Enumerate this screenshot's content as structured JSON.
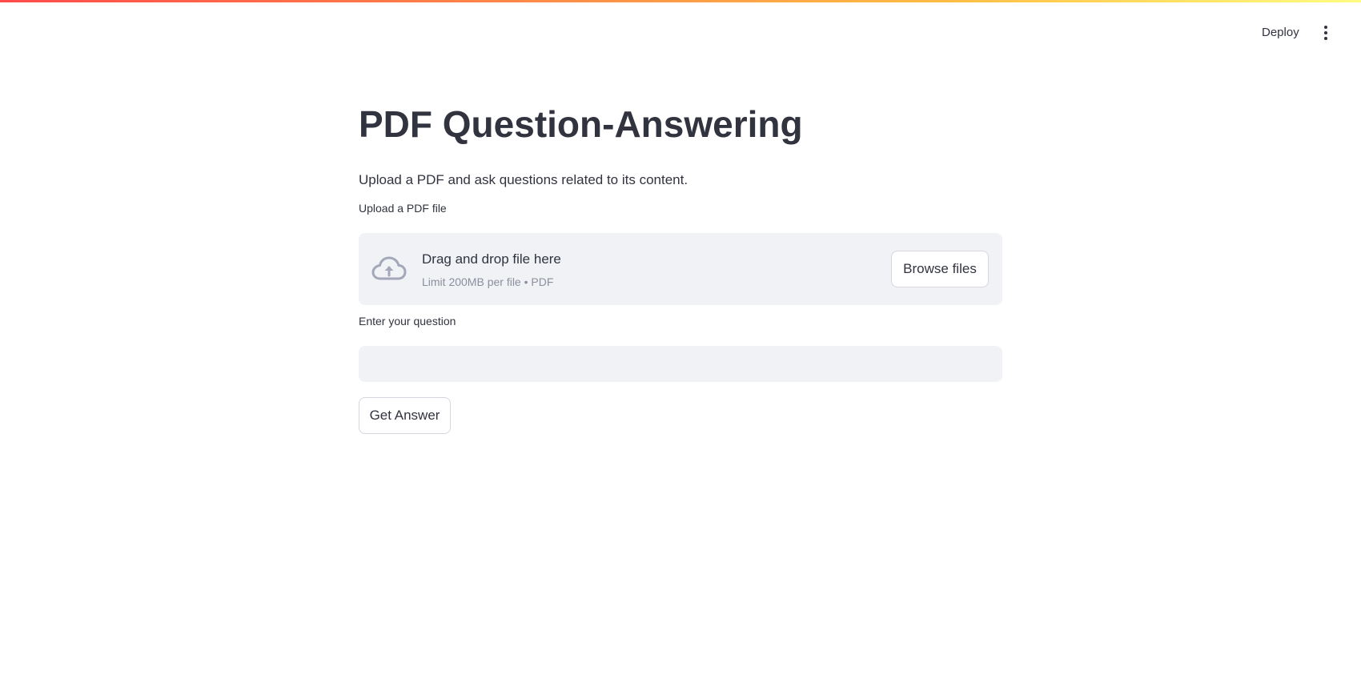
{
  "header": {
    "deploy_label": "Deploy",
    "menu_icon": "vertical-dots-icon"
  },
  "main": {
    "title": "PDF Question-Answering",
    "subtitle": "Upload a PDF and ask questions related to its content."
  },
  "uploader": {
    "label": "Upload a PDF file",
    "drop_text": "Drag and drop file here",
    "limit_text": "Limit 200MB per file • PDF",
    "browse_label": "Browse files",
    "icon": "cloud-upload-icon"
  },
  "question": {
    "label": "Enter your question",
    "value": "",
    "placeholder": ""
  },
  "actions": {
    "get_answer_label": "Get Answer"
  },
  "colors": {
    "text": "#31333f",
    "muted": "#8b8f9c",
    "input_bg": "#f0f2f6",
    "icon": "#a3a8b8",
    "accent_start": "#ff4b4b",
    "accent_end": "#fffd80"
  }
}
